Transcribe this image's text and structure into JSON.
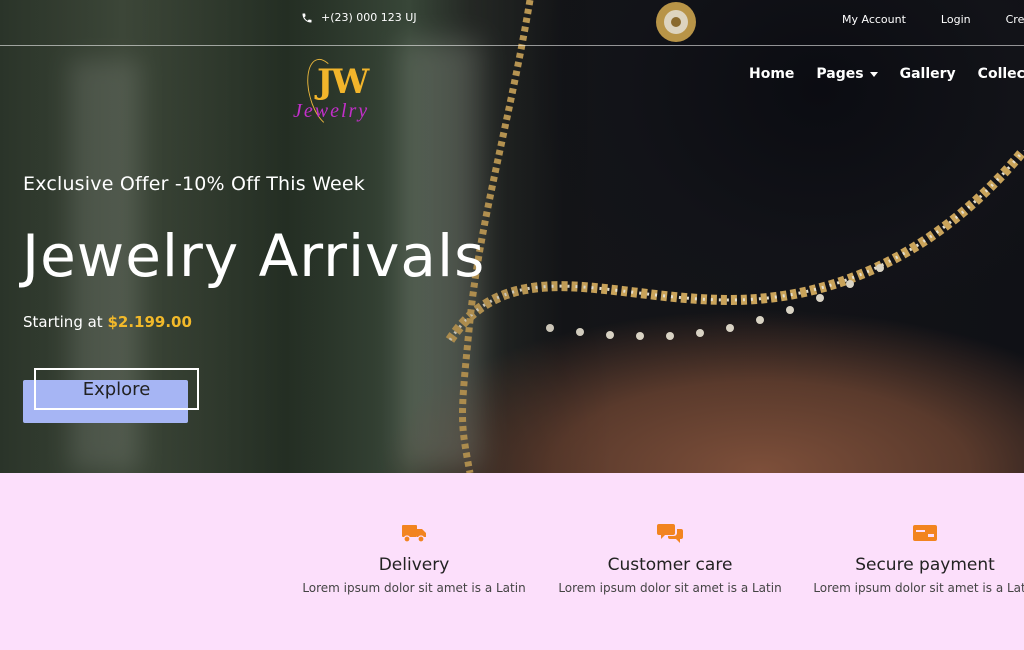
{
  "topbar": {
    "phone": "+(23) 000 123 UJ",
    "links": [
      "My Account",
      "Login",
      "Create"
    ]
  },
  "logo": {
    "mark": "JW",
    "word": "Jewelry"
  },
  "nav": {
    "items": [
      {
        "label": "Home"
      },
      {
        "label": "Pages",
        "dropdown": true
      },
      {
        "label": "Gallery"
      },
      {
        "label": "Collections"
      }
    ]
  },
  "hero": {
    "offer": "Exclusive Offer -10% Off This Week",
    "headline": "Jewelry Arrivals",
    "starting_label": "Starting at",
    "price": "$2.199.00",
    "cta": "Explore"
  },
  "features": [
    {
      "icon": "truck-icon",
      "title": "Delivery",
      "text": "Lorem ipsum dolor sit amet is a Latin"
    },
    {
      "icon": "chat-icon",
      "title": "Customer care",
      "text": "Lorem ipsum dolor sit amet is a Latin"
    },
    {
      "icon": "credit-card-icon",
      "title": "Secure payment",
      "text": "Lorem ipsum dolor sit amet is a Latin"
    }
  ],
  "colors": {
    "accent_orange": "#f2841f",
    "price_gold": "#f2b92a",
    "features_bg": "#fcdffb",
    "button_blue": "#a6b5f4",
    "logo_magenta": "#c22fc9"
  }
}
